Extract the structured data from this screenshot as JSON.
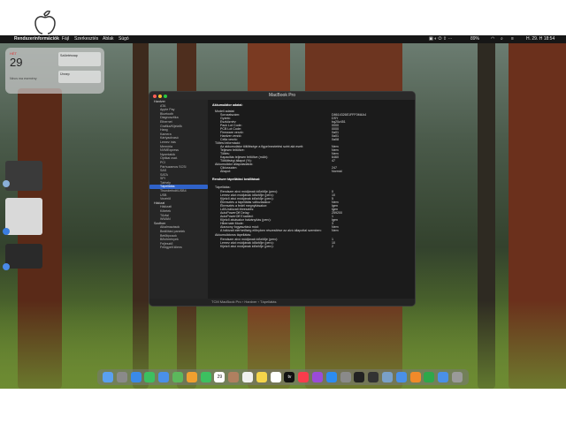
{
  "menubar": {
    "app_name": "Rendszerinformációk",
    "menus": [
      "Fájl",
      "Szerkesztés",
      "Ablak",
      "Súgó"
    ],
    "battery": "89%",
    "datetime": "H. 29.  H 18:54"
  },
  "widget": {
    "day_label": "HÉT",
    "day_number": "29",
    "no_events": "Nincs ma esemény",
    "event1": "Születésnap",
    "event2": "Ünnep"
  },
  "window": {
    "title": "MacBook Pro",
    "sidebar": [
      {
        "label": "Hardver",
        "section": true
      },
      {
        "label": "ATA"
      },
      {
        "label": "Apple Pay"
      },
      {
        "label": "Bluetooth"
      },
      {
        "label": "Diagnosztika"
      },
      {
        "label": "Ethernet"
      },
      {
        "label": "Grafika/Kijelzők"
      },
      {
        "label": "Hang"
      },
      {
        "label": "Kamera"
      },
      {
        "label": "Kártyaolvasó"
      },
      {
        "label": "Lemez írás"
      },
      {
        "label": "Memória"
      },
      {
        "label": "NVMExpress"
      },
      {
        "label": "Nyomtatók"
      },
      {
        "label": "Optikai csat."
      },
      {
        "label": "PCI"
      },
      {
        "label": "Párhuzamos SCSI"
      },
      {
        "label": "SAS"
      },
      {
        "label": "SATA"
      },
      {
        "label": "SPI"
      },
      {
        "label": "Tárhely"
      },
      {
        "label": "Tápellátás",
        "selected": true
      },
      {
        "label": "Thunderbolt/USB4"
      },
      {
        "label": "USB"
      },
      {
        "label": "Vezérlő"
      },
      {
        "label": "Hálózat",
        "section": true
      },
      {
        "label": "Hálózati"
      },
      {
        "label": "Kötetek"
      },
      {
        "label": "Tűzfal"
      },
      {
        "label": "WWAN"
      },
      {
        "label": "Szoftver",
        "section": true
      },
      {
        "label": "Alkalmazások"
      },
      {
        "label": "Beállítási panelek"
      },
      {
        "label": "Betűtípusok"
      },
      {
        "label": "Bővítmények"
      },
      {
        "label": "Fejlesztő"
      },
      {
        "label": "Felügyelt kliens"
      }
    ],
    "content": {
      "heading_battery": "Akkumulátor adatai:",
      "model_info": "Modell adatai:",
      "serial_label": "Sorozatszám:",
      "serial_value": "D8614326E1FFF0M4A4",
      "manufacturer_label": "Gyártó:",
      "manufacturer_value": "DSY",
      "device_label": "Eszköznév:",
      "device_value": "bq20z451",
      "pack_lot_label": "Pack Lot Code:",
      "pack_lot_value": "0000",
      "pcb_lot_label": "PCB Lot Code:",
      "pcb_lot_value": "0000",
      "firmware_label": "Firmware verzió:",
      "firmware_value": "0a01",
      "hardware_label": "Hardver verzió:",
      "hardware_value": "0a01",
      "cell_label": "Cella verzió:",
      "cell_value": "0a08",
      "charge_info": "Töltési információ:",
      "fully_charged_label": "Az akkumulátor töltöttsége a figyelmeztetési szint alá esett:",
      "fully_charged_value": "Nem",
      "fully_label": "Teljesen feltöltve:",
      "fully_value": "Nem",
      "charging_label": "Töltés:",
      "charging_value": "Nem",
      "capacity_label": "Kapacitás teljesen feltöltve (mAh):",
      "capacity_value": "6460",
      "state_label": "Töltöttségi állapot (%):",
      "state_value": "47",
      "health_info": "Akkumulátor állapotadatok:",
      "cycle_label": "Ciklusszám:",
      "cycle_value": "247",
      "condition_label": "Állapot:",
      "condition_value": "Normál",
      "heading_power": "Rendszer tápellátási beállításai:",
      "ac_power": "Tápellátás:",
      "sys_sleep_label": "Rendszer alvó módjának időzítője (perc):",
      "sys_sleep_value": "0",
      "disk_sleep_label": "Lemez alvó módjának időzítője (perc):",
      "disk_sleep_value": "10",
      "display_sleep_label": "Kijelző alvó módjának időzítője (perc):",
      "display_sleep_value": "5",
      "wake_ac_label": "Ébresztés a tápellátás változásakor:",
      "wake_ac_value": "Nem",
      "wake_lid_label": "Ébresztés a fedél megnyitásakor:",
      "wake_lid_value": "Igen",
      "wake_lan_label": "LAN-hálózati ébresztés:",
      "wake_lan_value": "Igen",
      "autopoweroff_delay_label": "AutoPowerOff Delay:",
      "autopoweroff_delay_value": "259200",
      "autopoweroff_label": "AutoPowerOff Enabled:",
      "autopoweroff_value": "1",
      "dim_label": "Kijelző alvásakor halványítás (perc):",
      "dim_value": "Igen",
      "hibernate_label": "Hibernate Mode:",
      "hibernate_value": "3",
      "lowpower_label": "Alacsony fogyasztású mód:",
      "lowpower_value": "Nem",
      "prioritize_label": "A hálózati elérhetőség előnyben részesítése az alvó állapottal szemben:",
      "prioritize_value": "Nem",
      "battery_power": "Akkumulátoros tápellátás:",
      "b_sys_sleep_label": "Rendszer alvó módjának időzítője (perc):",
      "b_sys_sleep_value": "1",
      "b_disk_sleep_label": "Lemez alvó módjának időzítője (perc):",
      "b_disk_sleep_value": "10",
      "b_display_sleep_label": "Kijelző alvó módjának időzítője (perc):",
      "b_display_sleep_value": "2"
    },
    "pathbar": "TCM MacBook Pro  ›  Hardver  ›  Tápellátás"
  },
  "dock": {
    "calendar_day": "29",
    "tv_label": "tv",
    "apps": [
      "finder-icon",
      "launchpad-icon",
      "safari-icon",
      "messages-icon",
      "mail-icon",
      "maps-icon",
      "photos-icon",
      "facetime-icon",
      "calendar-icon",
      "contacts-icon",
      "reminders-icon",
      "notes-icon",
      "freeform-icon",
      "tv-icon",
      "music-icon",
      "podcasts-icon",
      "appstore-icon",
      "settings-icon",
      "terminal-icon",
      "activity-icon",
      "preview-icon",
      "keynote-icon",
      "pages-icon",
      "numbers-icon",
      "downloads-icon",
      "trash-icon"
    ]
  }
}
